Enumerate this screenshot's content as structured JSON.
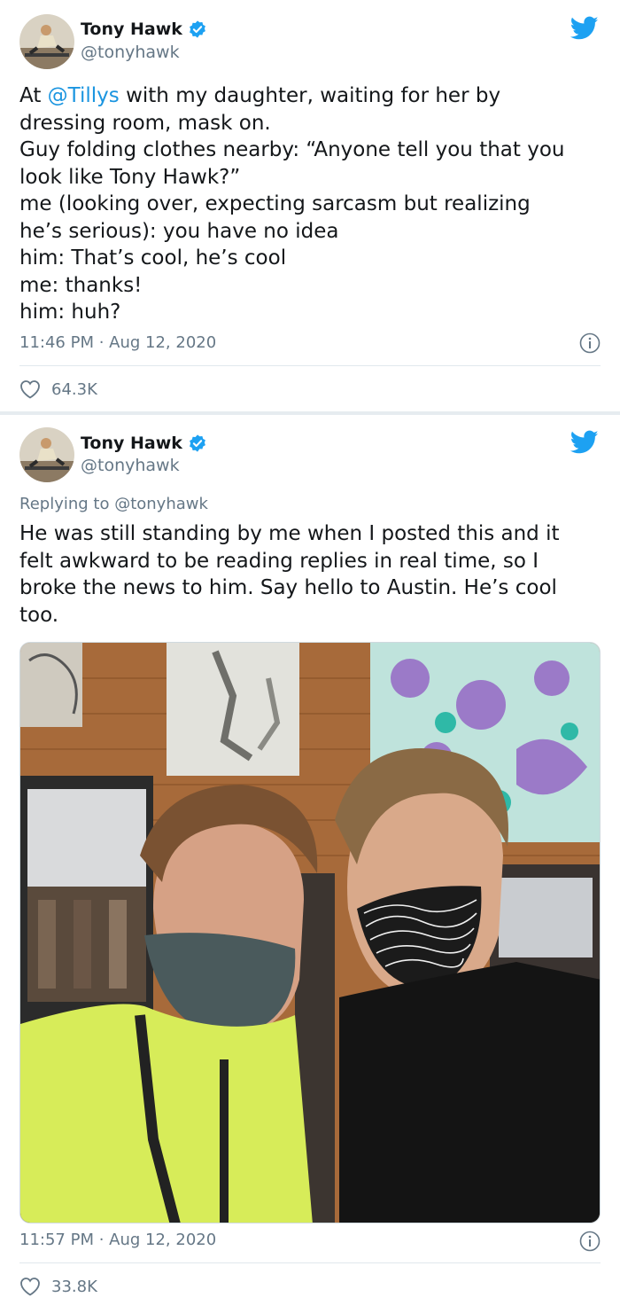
{
  "tweet1": {
    "author_name": "Tony Hawk",
    "author_handle": "@tonyhawk",
    "lines": [
      {
        "pre": "At ",
        "mention": "@Tillys",
        "post": " with my daughter, waiting for her by"
      },
      {
        "pre": "dressing room, mask on.",
        "mention": "",
        "post": ""
      },
      {
        "pre": "Guy folding clothes nearby: “Anyone tell you that you",
        "mention": "",
        "post": ""
      },
      {
        "pre": "look like Tony Hawk?”",
        "mention": "",
        "post": ""
      },
      {
        "pre": "me (looking over, expecting sarcasm but realizing",
        "mention": "",
        "post": ""
      },
      {
        "pre": "he’s serious): you have no idea",
        "mention": "",
        "post": ""
      },
      {
        "pre": "him: That’s cool, he’s cool",
        "mention": "",
        "post": ""
      },
      {
        "pre": "me: thanks!",
        "mention": "",
        "post": ""
      },
      {
        "pre": "him: huh?",
        "mention": "",
        "post": ""
      }
    ],
    "timestamp": "11:46 PM · Aug 12, 2020",
    "likes": "64.3K"
  },
  "tweet2": {
    "author_name": "Tony Hawk",
    "author_handle": "@tonyhawk",
    "replying_to": "Replying to @tonyhawk",
    "lines": [
      "He was still standing by me when I posted this and it",
      "felt awkward to be reading replies in real time, so I",
      "broke the news to him. Say hello to Austin. He’s cool",
      "too."
    ],
    "timestamp": "11:57 PM · Aug 12, 2020",
    "likes": "33.8K"
  },
  "colors": {
    "accent": "#1da1f2",
    "link": "#1b95e0",
    "muted": "#657786",
    "text": "#14171a"
  },
  "icons": [
    "twitter-bird-icon",
    "verified-badge-icon",
    "info-icon",
    "heart-icon"
  ]
}
